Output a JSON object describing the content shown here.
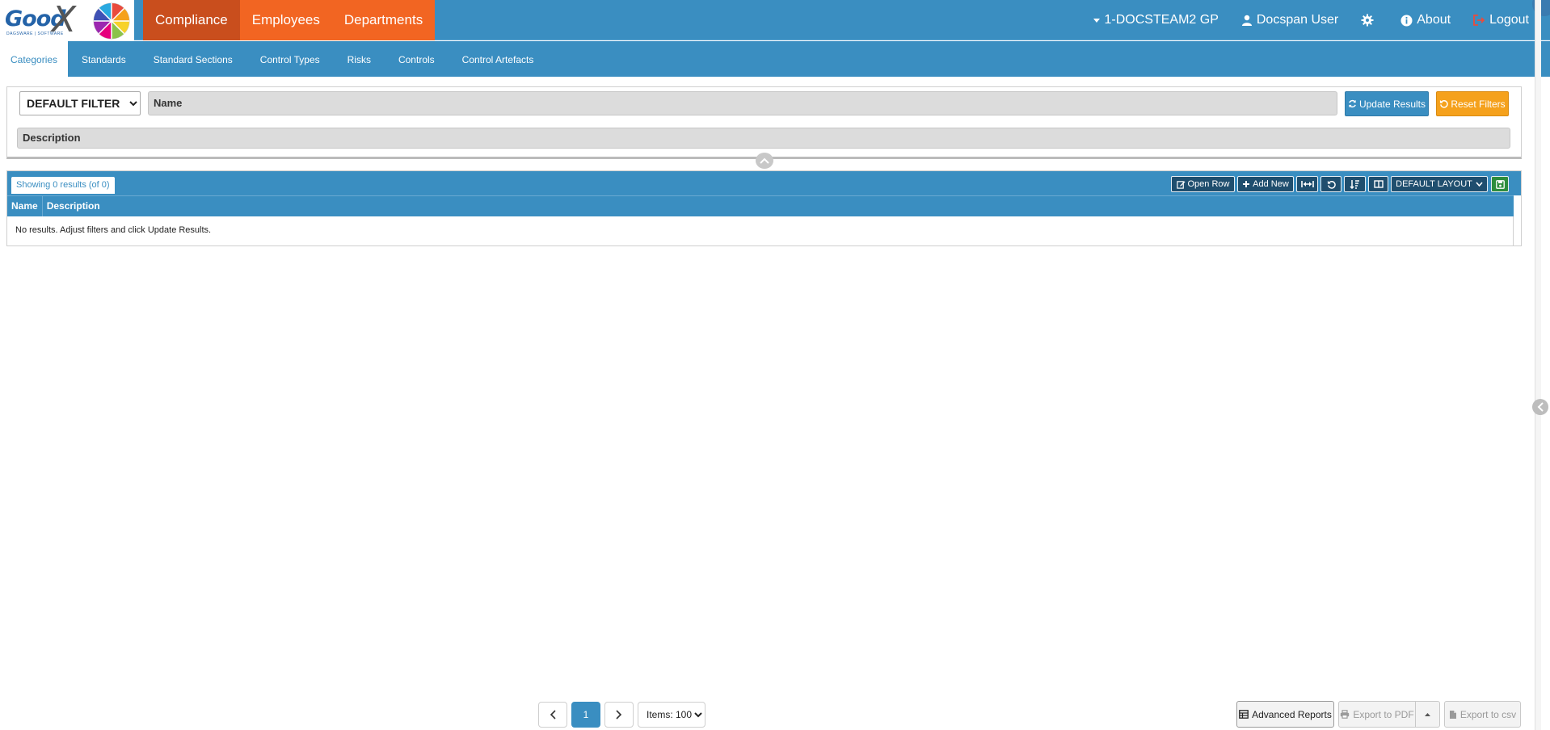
{
  "brand": {
    "logo_text": "Good",
    "logo_mark": "X",
    "logo_sub": "DAGSWARE | SOFTWARE"
  },
  "main_nav": [
    {
      "label": "Compliance",
      "active": true
    },
    {
      "label": "Employees",
      "active": false
    },
    {
      "label": "Departments",
      "active": false
    }
  ],
  "right_nav": {
    "entity": "1-DOCSTEAM2 GP",
    "user": "Docspan User",
    "about": "About",
    "logout": "Logout"
  },
  "sub_nav": [
    {
      "label": "Categories",
      "active": true
    },
    {
      "label": "Standards",
      "active": false
    },
    {
      "label": "Standard Sections",
      "active": false
    },
    {
      "label": "Control Types",
      "active": false
    },
    {
      "label": "Risks",
      "active": false
    },
    {
      "label": "Controls",
      "active": false
    },
    {
      "label": "Control Artefacts",
      "active": false
    }
  ],
  "filters": {
    "filter_select": "DEFAULT FILTER",
    "name_label": "Name",
    "description_label": "Description",
    "update_label": "Update Results",
    "reset_label": "Reset Filters"
  },
  "grid": {
    "results_text": "Showing 0 results (of 0)",
    "open_row": "Open Row",
    "add_new": "Add New",
    "layout": "DEFAULT LAYOUT",
    "columns": [
      "Name",
      "Description"
    ],
    "empty_message": "No results. Adjust filters and click Update Results."
  },
  "pagination": {
    "current_page": "1",
    "items_label": "Items: 100"
  },
  "footer_buttons": {
    "advanced_reports": "Advanced Reports",
    "export_pdf": "Export to PDF",
    "export_csv": "Export to csv"
  },
  "colors": {
    "primary": "#3a8ec1",
    "orange": "#f26522",
    "orange_active": "#c94e1d",
    "warning": "#f5a11c",
    "save_green": "#2d8c3c"
  }
}
